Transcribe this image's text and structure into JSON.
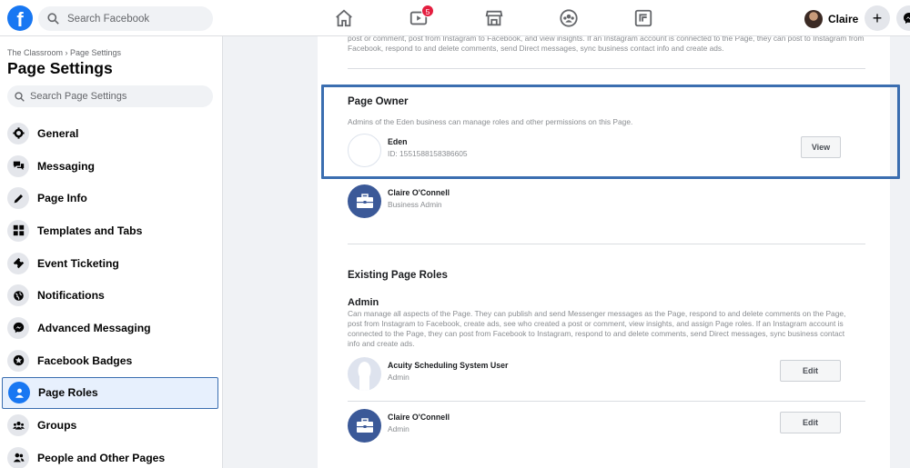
{
  "topbar": {
    "logo": "f",
    "search_placeholder": "Search Facebook",
    "notification_count": "5",
    "profile_name": "Claire",
    "icons": [
      "home-icon",
      "watch-icon",
      "marketplace-icon",
      "groups-icon",
      "gaming-icon",
      "plus-icon",
      "messenger-icon"
    ]
  },
  "sidebar": {
    "breadcrumb": "The Classroom › Page Settings",
    "title": "Page Settings",
    "search_placeholder": "Search Page Settings",
    "items": [
      {
        "label": "General",
        "icon": "gear-icon"
      },
      {
        "label": "Messaging",
        "icon": "chat-icon"
      },
      {
        "label": "Page Info",
        "icon": "pencil-icon"
      },
      {
        "label": "Templates and Tabs",
        "icon": "grid-icon"
      },
      {
        "label": "Event Ticketing",
        "icon": "ticket-icon"
      },
      {
        "label": "Notifications",
        "icon": "globe-icon"
      },
      {
        "label": "Advanced Messaging",
        "icon": "messenger-icon"
      },
      {
        "label": "Facebook Badges",
        "icon": "badge-icon"
      },
      {
        "label": "Page Roles",
        "icon": "person-icon",
        "active": true
      },
      {
        "label": "Groups",
        "icon": "groups-icon"
      },
      {
        "label": "People and Other Pages",
        "icon": "people-icon"
      }
    ]
  },
  "main": {
    "top_text": "post or comment, post from Instagram to Facebook, and view insights. If an Instagram account is connected to the Page, they can post to Instagram from Facebook, respond to and delete comments, send Direct messages, sync business contact info and create ads.",
    "owner": {
      "title": "Page Owner",
      "description": "Admins of the Eden business can manage roles and other permissions on this Page.",
      "name": "Eden",
      "id": "ID: 1551588158386605",
      "button": "View"
    },
    "business_admin": {
      "name": "Claire O'Connell",
      "role": "Business Admin"
    },
    "existing": {
      "title": "Existing Page Roles",
      "admin_title": "Admin",
      "admin_desc": "Can manage all aspects of the Page. They can publish and send Messenger messages as the Page, respond to and delete comments on the Page, post from Instagram to Facebook, create ads, see who created a post or comment, view insights, and assign Page roles. If an Instagram account is connected to the Page, they can post from Facebook to Instagram, respond to and delete comments, send Direct messages, sync business contact info and create ads.",
      "roles": [
        {
          "name": "Acuity Scheduling System User",
          "role": "Admin",
          "button": "Edit"
        },
        {
          "name": "Claire O'Connell",
          "role": "Admin",
          "button": "Edit"
        }
      ]
    }
  },
  "colors": {
    "brand": "#1877f2",
    "highlight": "#3b6eb0",
    "badge": "#e41e3f"
  }
}
